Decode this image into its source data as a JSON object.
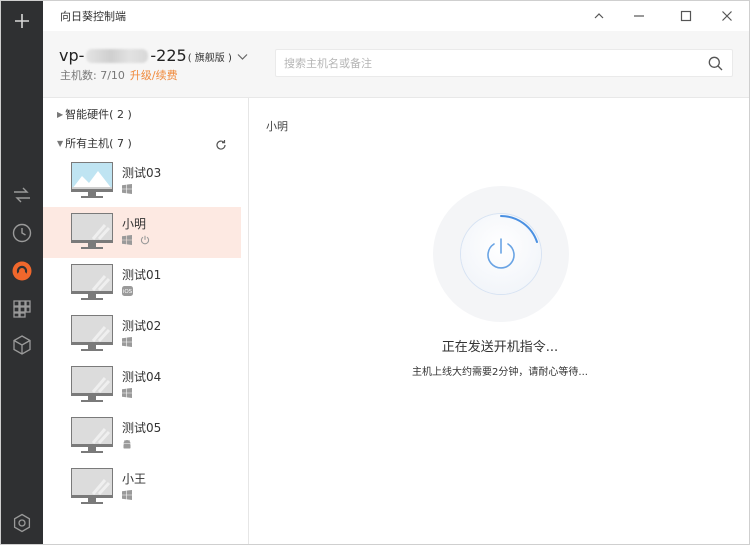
{
  "app": {
    "title": "向日葵控制端"
  },
  "account": {
    "name_prefix": "vp-",
    "name_suffix": "-225",
    "edition": "( 旗舰版 )",
    "host_count_label": "主机数: 7/10",
    "upgrade_label": "升级/续费"
  },
  "search": {
    "placeholder": "搜索主机名或备注"
  },
  "groups": [
    {
      "label": "智能硬件( 2 )",
      "expanded": false
    },
    {
      "label": "所有主机( 7 )",
      "expanded": true
    }
  ],
  "hosts": [
    {
      "name": "测试03",
      "os": "windows-icon",
      "selected": false
    },
    {
      "name": "小明",
      "os": "windows-icon",
      "selected": true,
      "power": "power-icon"
    },
    {
      "name": "测试01",
      "os": "ios-icon",
      "selected": false
    },
    {
      "name": "测试02",
      "os": "windows-icon",
      "selected": false
    },
    {
      "name": "测试04",
      "os": "windows-icon",
      "selected": false
    },
    {
      "name": "测试05",
      "os": "android-icon",
      "selected": false
    },
    {
      "name": "小王",
      "os": "windows-icon",
      "selected": false
    }
  ],
  "detail": {
    "host_title": "小明",
    "status_main": "正在发送开机指令...",
    "status_sub": "主机上线大约需要2分钟，请耐心等待..."
  },
  "colors": {
    "rail": "#2f3032",
    "accent": "#f08a3c",
    "selected_row": "#fde9e2",
    "boot_ring": "#4a90e2"
  }
}
